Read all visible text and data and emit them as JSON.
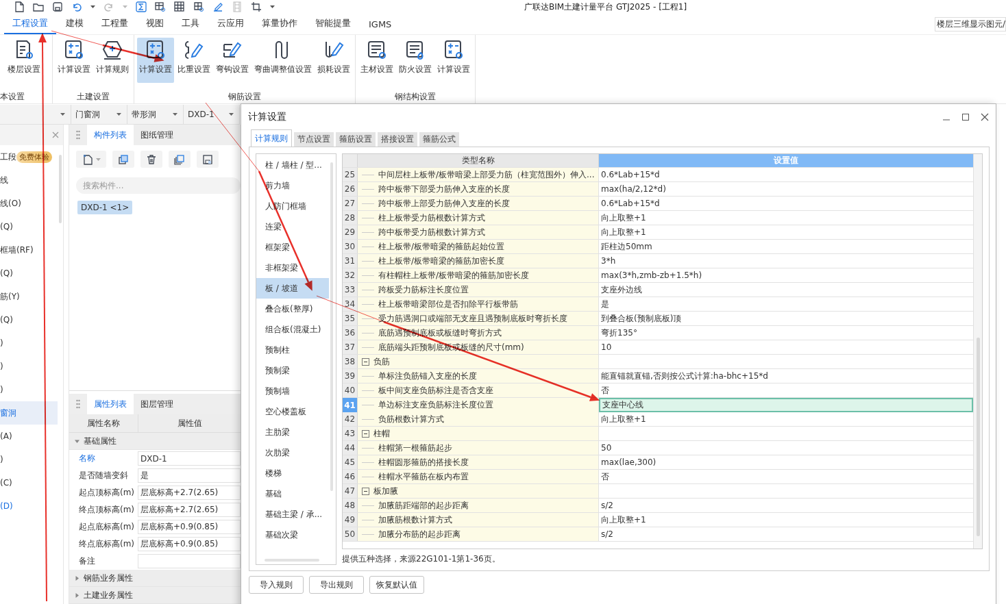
{
  "window": {
    "title": "广联达BIM土建计量平台 GTJ2025 - [工程1]"
  },
  "menu_tabs": [
    {
      "label": "工程设置",
      "selected": true
    },
    {
      "label": "建模",
      "selected": false
    },
    {
      "label": "工程量",
      "selected": false
    },
    {
      "label": "视图",
      "selected": false
    },
    {
      "label": "工具",
      "selected": false
    },
    {
      "label": "云应用",
      "selected": false
    },
    {
      "label": "算量协作",
      "selected": false
    },
    {
      "label": "智能提量",
      "selected": false
    },
    {
      "label": "IGMS",
      "selected": false
    }
  ],
  "menu_right_text": "楼层三维显示图元/",
  "ribbon_groups": [
    {
      "label": "本设置",
      "items": [
        {
          "label": "楼层设置",
          "selected": false
        }
      ]
    },
    {
      "label": "土建设置",
      "items": [
        {
          "label": "计算设置",
          "selected": false
        },
        {
          "label": "计算规则",
          "selected": false
        }
      ]
    },
    {
      "label": "钢筋设置",
      "items": [
        {
          "label": "计算设置",
          "selected": true
        },
        {
          "label": "比重设置",
          "selected": false
        },
        {
          "label": "弯钩设置",
          "selected": false
        },
        {
          "label": "弯曲调整值设置",
          "selected": false
        },
        {
          "label": "损耗设置",
          "selected": false
        }
      ]
    },
    {
      "label": "钢结构设置",
      "items": [
        {
          "label": "主材设置",
          "selected": false
        },
        {
          "label": "防火设置",
          "selected": false
        },
        {
          "label": "计算设置",
          "selected": false
        }
      ]
    }
  ],
  "dropdowns": [
    "门窗洞",
    "带形洞",
    "DXD-1"
  ],
  "nav_panel": {
    "items": [
      {
        "label": "工段",
        "badge": "免费体验",
        "selected": false,
        "active": false
      },
      {
        "label": "线",
        "selected": false,
        "active": false
      },
      {
        "label": "线(O)",
        "selected": false,
        "active": false
      },
      {
        "label": "(Q)",
        "selected": false,
        "active": false
      },
      {
        "label": "框墙(RF)",
        "selected": false,
        "active": false
      },
      {
        "label": "(Q)",
        "selected": false,
        "active": false
      },
      {
        "label": "筋(Y)",
        "selected": false,
        "active": false
      },
      {
        "label": "(Q)",
        "selected": false,
        "active": false
      },
      {
        "label": ")",
        "selected": false,
        "active": false
      },
      {
        "label": ")",
        "selected": false,
        "active": false
      },
      {
        "label": ")",
        "selected": false,
        "active": false
      },
      {
        "label": "窗洞",
        "selected": true,
        "active": true
      },
      {
        "label": "(A)",
        "selected": false,
        "active": false
      },
      {
        "label": ")",
        "selected": false,
        "active": false
      },
      {
        "label": "(C)",
        "selected": false,
        "active": false
      },
      {
        "label": "(D)",
        "selected": false,
        "active": true
      }
    ]
  },
  "component_panel": {
    "tabs": [
      {
        "label": "构件列表",
        "selected": true
      },
      {
        "label": "图纸管理",
        "selected": false
      }
    ],
    "search": {
      "placeholder": "搜索构件..."
    },
    "items": [
      {
        "label": "DXD-1 <1>",
        "selected": true
      }
    ]
  },
  "property_panel": {
    "tabs": [
      {
        "label": "属性列表",
        "selected": true
      },
      {
        "label": "图层管理",
        "selected": false
      }
    ],
    "columns": [
      "属性名称",
      "属性值"
    ],
    "groups": [
      {
        "label": "基础属性",
        "expanded": true,
        "rows": [
          {
            "name": "名称",
            "value": "DXD-1",
            "public": true
          },
          {
            "name": "是否随墙变斜",
            "value": "是",
            "public": false
          },
          {
            "name": "起点顶标高(m)",
            "value": "层底标高+2.7(2.65)",
            "public": false
          },
          {
            "name": "终点顶标高(m)",
            "value": "层底标高+2.7(2.65)",
            "public": false
          },
          {
            "name": "起点底标高(m)",
            "value": "层底标高+0.9(0.85)",
            "public": false
          },
          {
            "name": "终点底标高(m)",
            "value": "层底标高+0.9(0.85)",
            "public": false
          },
          {
            "name": "备注",
            "public": false
          }
        ]
      },
      {
        "label": "钢筋业务属性",
        "expanded": false
      },
      {
        "label": "土建业务属性",
        "expanded": false
      }
    ]
  },
  "dialog": {
    "title": "计算设置",
    "tabs": [
      {
        "label": "计算规则",
        "selected": true
      },
      {
        "label": "节点设置",
        "selected": false
      },
      {
        "label": "箍筋设置",
        "selected": false
      },
      {
        "label": "搭接设置",
        "selected": false
      },
      {
        "label": "箍筋公式",
        "selected": false
      }
    ],
    "categories": [
      {
        "label": "柱 / 墙柱 / 型...",
        "selected": false
      },
      {
        "label": "剪力墙",
        "selected": false
      },
      {
        "label": "人防门框墙",
        "selected": false
      },
      {
        "label": "连梁",
        "selected": false
      },
      {
        "label": "框架梁",
        "selected": false
      },
      {
        "label": "非框架梁",
        "selected": false
      },
      {
        "label": "板 / 坡道",
        "selected": true
      },
      {
        "label": "叠合板(整厚)",
        "selected": false
      },
      {
        "label": "组合板(混凝土)",
        "selected": false
      },
      {
        "label": "预制柱",
        "selected": false
      },
      {
        "label": "预制梁",
        "selected": false
      },
      {
        "label": "预制墙",
        "selected": false
      },
      {
        "label": "空心楼盖板",
        "selected": false
      },
      {
        "label": "主肋梁",
        "selected": false
      },
      {
        "label": "次肋梁",
        "selected": false
      },
      {
        "label": "楼梯",
        "selected": false
      },
      {
        "label": "基础",
        "selected": false
      },
      {
        "label": "基础主梁 / 承...",
        "selected": false
      },
      {
        "label": "基础次梁",
        "selected": false
      }
    ],
    "table": {
      "columns": [
        "类型名称",
        "设置值"
      ],
      "rows": [
        {
          "no": "25",
          "kind": "item",
          "name": "中间层柱上板带/板带暗梁上部受力筋（柱宽范围外）伸入...",
          "value": "0.6*Lab+15*d",
          "selected": false
        },
        {
          "no": "26",
          "kind": "item",
          "name": "跨中板带下部受力筋伸入支座的长度",
          "value": "max(ha/2,12*d)",
          "selected": false
        },
        {
          "no": "27",
          "kind": "item",
          "name": "跨中板带上部受力筋伸入支座的长度",
          "value": "0.6*Lab+15*d",
          "selected": false
        },
        {
          "no": "28",
          "kind": "item",
          "name": "柱上板带受力筋根数计算方式",
          "value": "向上取整+1",
          "selected": false
        },
        {
          "no": "29",
          "kind": "item",
          "name": "跨中板带受力筋根数计算方式",
          "value": "向上取整+1",
          "selected": false
        },
        {
          "no": "30",
          "kind": "item",
          "name": "柱上板带/板带暗梁的箍筋起始位置",
          "value": "距柱边50mm",
          "selected": false
        },
        {
          "no": "31",
          "kind": "item",
          "name": "柱上板带/板带暗梁的箍筋加密长度",
          "value": "3*h",
          "selected": false
        },
        {
          "no": "32",
          "kind": "item",
          "name": "有柱帽柱上板带/板带暗梁的箍筋加密长度",
          "value": "max(3*h,zmb-zb+1.5*h)",
          "selected": false
        },
        {
          "no": "33",
          "kind": "item",
          "name": "跨板受力筋标注长度位置",
          "value": "支座外边线",
          "selected": false
        },
        {
          "no": "34",
          "kind": "item",
          "name": "柱上板带暗梁部位是否扣除平行板带筋",
          "value": "是",
          "selected": false
        },
        {
          "no": "35",
          "kind": "item",
          "name": "受力筋遇洞口或端部无支座且遇预制底板时弯折长度",
          "value": "到叠合板(预制底板)顶",
          "selected": false
        },
        {
          "no": "36",
          "kind": "item",
          "name": "底筋遇预制底板或板缝时弯折方式",
          "value": "弯折135°",
          "selected": false
        },
        {
          "no": "37",
          "kind": "item",
          "name": "底筋端头距预制底板或板缝的尺寸(mm)",
          "value": "10",
          "selected": false
        },
        {
          "no": "38",
          "kind": "group",
          "name": "负筋",
          "expanded": true,
          "selected": false
        },
        {
          "no": "39",
          "kind": "item",
          "name": "单标注负筋锚入支座的长度",
          "value": "能直锚就直锚,否则按公式计算:ha-bhc+15*d",
          "selected": false
        },
        {
          "no": "40",
          "kind": "item",
          "name": "板中间支座负筋标注是否含支座",
          "value": "否",
          "selected": false
        },
        {
          "no": "41",
          "kind": "item",
          "name": "单边标注支座负筋标注长度位置",
          "value": "支座中心线",
          "selected": true
        },
        {
          "no": "42",
          "kind": "item",
          "name": "负筋根数计算方式",
          "value": "向上取整+1",
          "selected": false
        },
        {
          "no": "43",
          "kind": "group",
          "name": "柱帽",
          "expanded": true,
          "selected": false
        },
        {
          "no": "44",
          "kind": "item",
          "name": "柱帽第一根箍筋起步",
          "value": "50",
          "selected": false
        },
        {
          "no": "45",
          "kind": "item",
          "name": "柱帽圆形箍筋的搭接长度",
          "value": "max(lae,300)",
          "selected": false
        },
        {
          "no": "46",
          "kind": "item",
          "name": "柱帽水平箍筋在板内布置",
          "value": "否",
          "selected": false
        },
        {
          "no": "47",
          "kind": "group",
          "name": "板加腋",
          "expanded": true,
          "selected": false
        },
        {
          "no": "48",
          "kind": "item",
          "name": "加腋筋距端部的起步距离",
          "value": "s/2",
          "selected": false
        },
        {
          "no": "49",
          "kind": "item",
          "name": "加腋筋根数计算方式",
          "value": "向上取整+1",
          "selected": false
        },
        {
          "no": "50",
          "kind": "item",
          "name": "加腋分布筋的起步距离",
          "value": "s/2",
          "selected": false
        }
      ]
    },
    "description": "提供五种选择，来源22G101-1第1-36页。",
    "buttons": [
      "导入规则",
      "导出规则",
      "恢复默认值"
    ]
  }
}
